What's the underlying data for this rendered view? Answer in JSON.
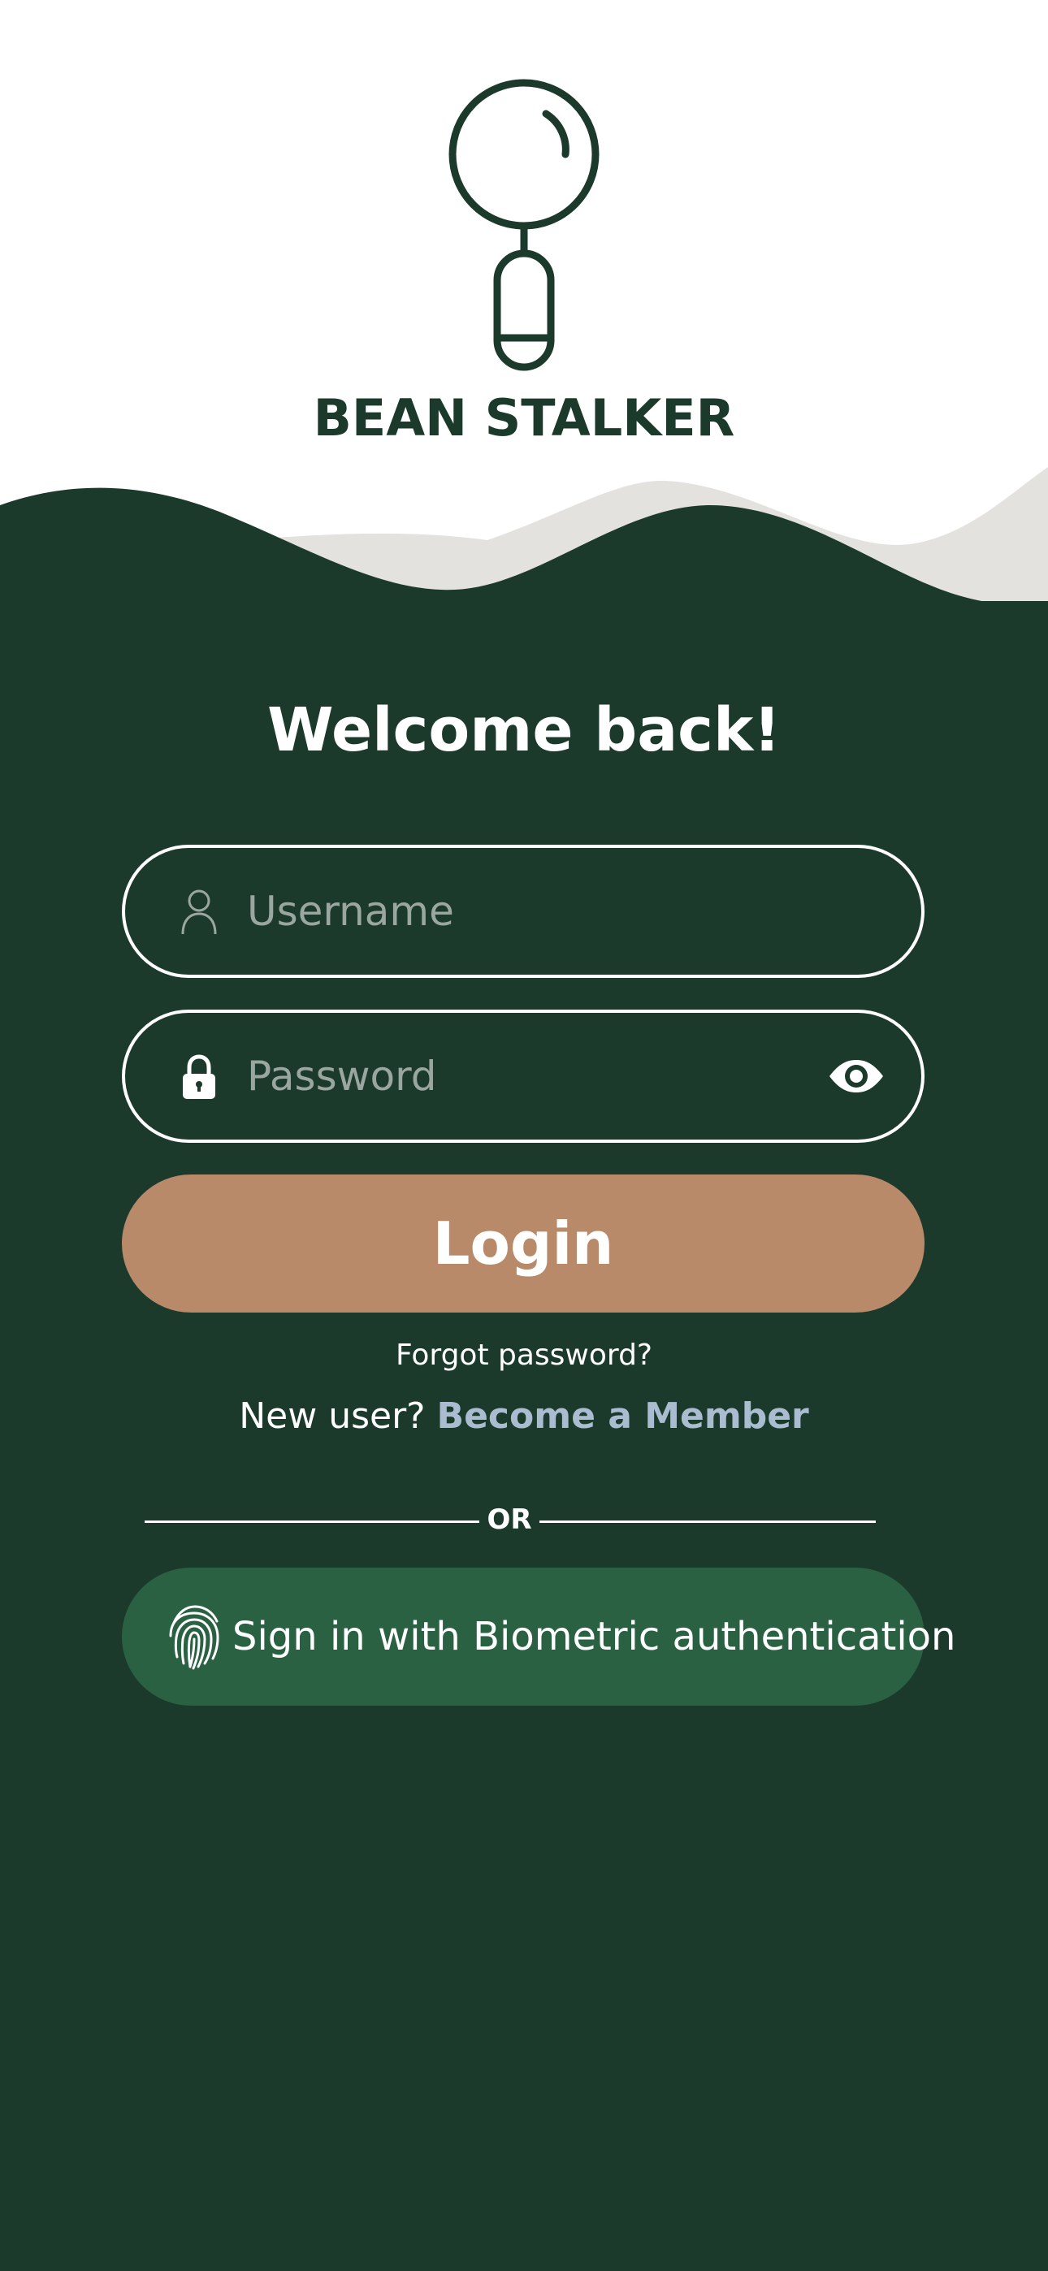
{
  "brand": {
    "name": "BEAN STALKER",
    "logo_icon": "magnifier-bean-icon",
    "colors": {
      "primary": "#1c3a2b",
      "background_top": "#ffffff",
      "wave_secondary": "#e4e2df"
    }
  },
  "login": {
    "title": "Welcome back!",
    "username": {
      "placeholder": "Username",
      "value": "",
      "icon": "user-icon"
    },
    "password": {
      "placeholder": "Password",
      "value": "",
      "icon": "lock-icon",
      "toggle_icon": "eye-icon"
    },
    "login_button": {
      "label": "Login",
      "color": "#b98a69"
    },
    "forgot_password": "Forgot password?",
    "new_user": {
      "prompt": "New user?",
      "link": "Become a Member",
      "link_color": "#a9bcd0"
    },
    "divider_text": "OR",
    "biometric_button": {
      "label": "Sign in with Biometric authentication",
      "icon": "fingerprint-icon",
      "color": "#2a6142"
    }
  }
}
